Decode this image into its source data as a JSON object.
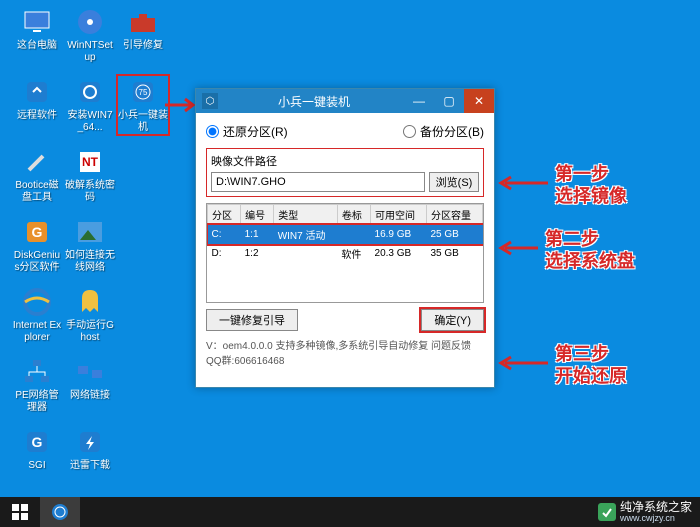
{
  "desktop": {
    "icons": [
      {
        "label": "这台电脑"
      },
      {
        "label": "WinNTSetup"
      },
      {
        "label": "引导修复"
      },
      {
        "label": "远程软件"
      },
      {
        "label": "安装WIN7_64..."
      },
      {
        "label": "小兵一键装机"
      },
      {
        "label": "Bootice磁盘工具"
      },
      {
        "label": "破解系统密码"
      },
      {
        "label": "DiskGenius分区软件"
      },
      {
        "label": "如何连接无线网络"
      },
      {
        "label": "Internet Explorer"
      },
      {
        "label": "手动运行Ghost"
      },
      {
        "label": "PE网络管理器"
      },
      {
        "label": "网络链接"
      },
      {
        "label": "SGI"
      },
      {
        "label": "迅雷下载"
      }
    ]
  },
  "window": {
    "title": "小兵一键装机",
    "mode": {
      "restore": "还原分区(R)",
      "backup": "备份分区(B)"
    },
    "image_label": "映像文件路径",
    "image_path": "D:\\WIN7.GHO",
    "browse": "浏览(S)",
    "table": {
      "headers": [
        "分区",
        "编号",
        "类型",
        "卷标",
        "可用空间",
        "分区容量"
      ],
      "rows": [
        {
          "part": "C:",
          "idx": "1:1",
          "type": "WIN7 活动",
          "vol": "",
          "free": "16.9 GB",
          "size": "25 GB",
          "selected": true
        },
        {
          "part": "D:",
          "idx": "1:2",
          "type": "",
          "vol": "软件",
          "free": "20.3 GB",
          "size": "35 GB",
          "selected": false
        }
      ]
    },
    "fix_boot": "一键修复引导",
    "ok": "确定(Y)",
    "footer": "V：oem4.0.0.0       支持多种镜像,多系统引导自动修复 问题反馈QQ群:606616468"
  },
  "annotations": {
    "step1_title": "第一步",
    "step1_text": "选择镜像",
    "step2_title": "第二步",
    "step2_text": "选择系统盘",
    "step3_title": "第三步",
    "step3_text": "开始还原"
  },
  "watermark": {
    "name": "纯净系统之家",
    "url": "www.cwjzy.cn"
  }
}
